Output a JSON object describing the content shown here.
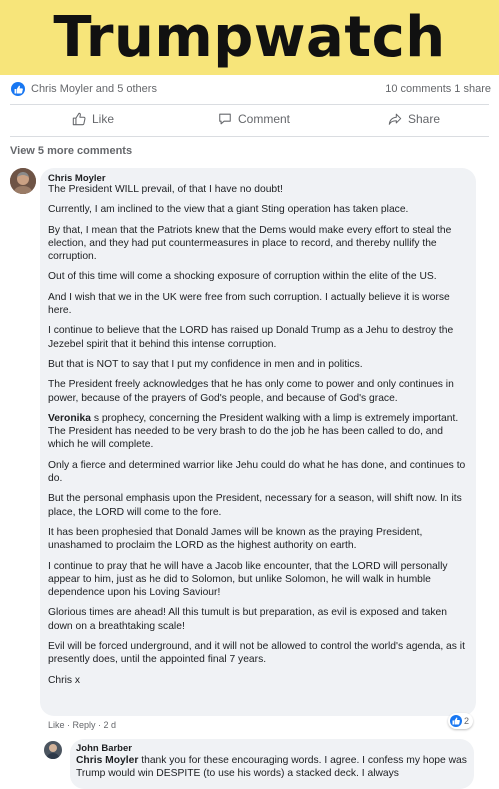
{
  "banner": {
    "title": "Trumpwatch"
  },
  "post_stats": {
    "reactors": "Chris Moyler and 5 others",
    "counts": "10 comments  1 share"
  },
  "actions": {
    "like": "Like",
    "comment": "Comment",
    "share": "Share"
  },
  "view_more": "View 5 more comments",
  "comment": {
    "author": "Chris Moyler",
    "paragraphs": [
      "The President WILL prevail, of that I have no doubt!",
      "Currently, I am inclined to the view that a giant Sting operation has taken place.",
      "By that, I mean that the Patriots knew that the Dems would make every effort to steal the election, and they had put countermeasures in place to record, and thereby nullify the corruption.",
      "Out of this time will come a shocking exposure of corruption within the elite of the US.",
      "And I wish that we in the UK were free from such corruption. I actually believe it is worse here.",
      "I continue to believe that the LORD has raised up Donald Trump as a Jehu to destroy the Jezebel spirit that it behind this intense corruption.",
      "But that is NOT to say that I put my confidence in men and in politics.",
      "The President freely acknowledges that he has only come to power and only continues in power, because of the prayers of God's people, and because of God's grace.",
      "s prophecy, concerning the President walking with a limp is extremely important. The President has needed to be very brash to do the job he has been called to do, and which he will complete.",
      "Only a fierce and determined warrior like Jehu could do what he has done, and continues to do.",
      "But the personal emphasis upon the President, necessary for a season, will shift now. In its place, the LORD will come to the fore.",
      "It has been prophesied that Donald James will be known as the praying President, unashamed to proclaim the LORD as the highest authority on earth.",
      "I continue to pray that he will have a Jacob like encounter, that the LORD will personally appear to him, just as he did to Solomon, but unlike Solomon, he will walk in humble dependence upon his Loving Saviour!",
      "Glorious times are ahead! All this tumult is but preparation, as evil is exposed and taken down on a breathtaking scale!",
      "Evil will be forced underground, and it will not be allowed to control the world's agenda, as it presently does, until the appointed final 7 years.",
      "Chris x"
    ],
    "mention": "Veronika",
    "meta": "Like · Reply · 2 d",
    "reaction_count": "2"
  },
  "reply": {
    "author": "John Barber",
    "mention": "Chris Moyler",
    "text": " thank you for these encouraging words. I agree. I confess my hope was Trump would win DESPITE (to use his words) a stacked deck. I always"
  },
  "colors": {
    "banner": "#f7e57a",
    "bubble": "#f0f2f5",
    "like_blue": "#1877f2"
  }
}
